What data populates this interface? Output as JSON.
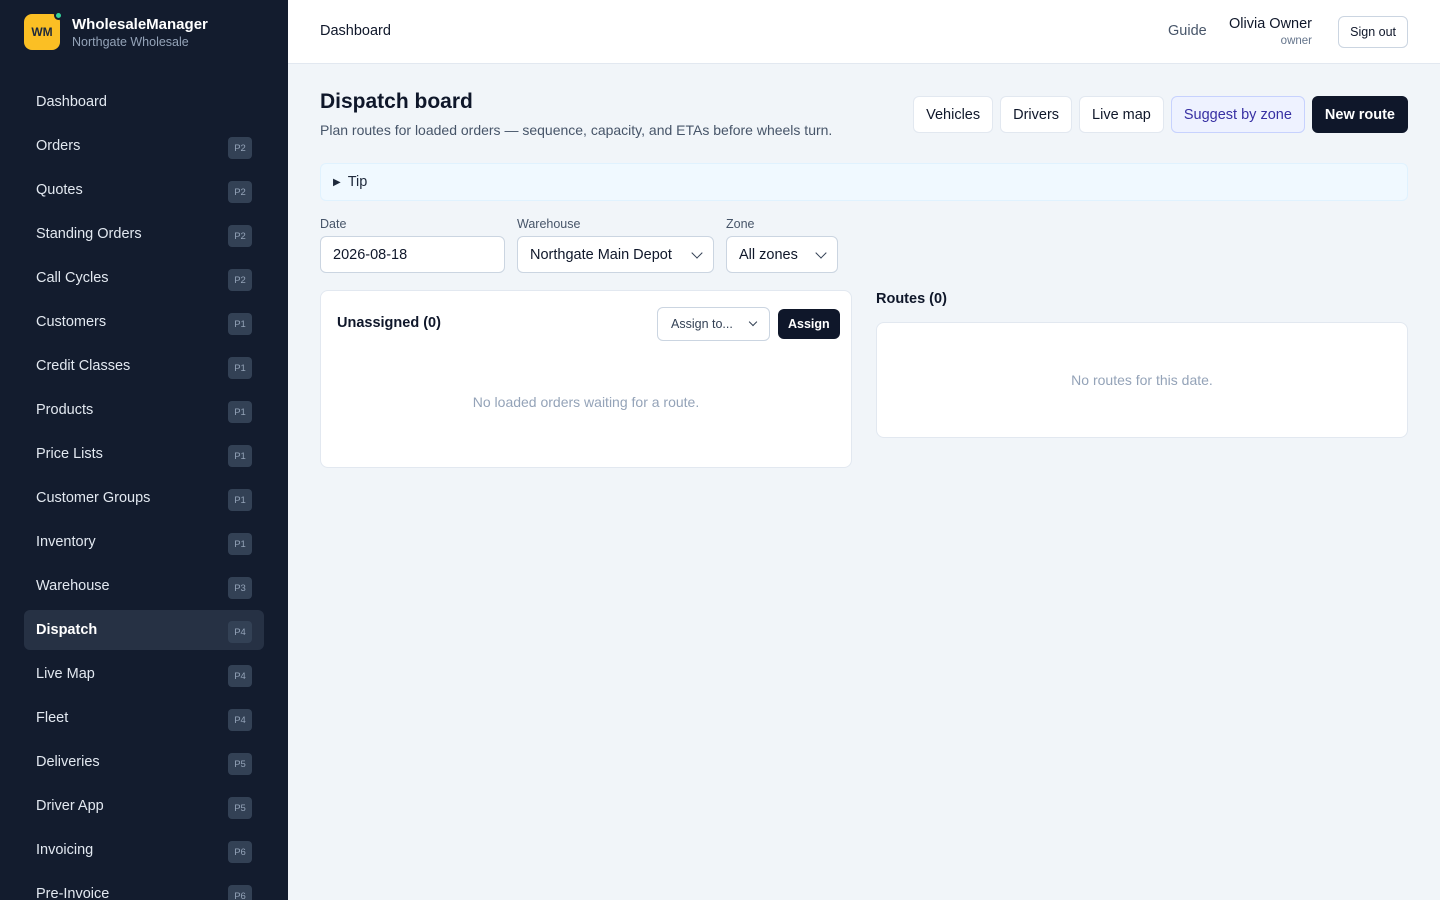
{
  "brand": {
    "logo": "WM",
    "name": "WholesaleManager",
    "company": "Northgate Wholesale"
  },
  "sidebar": {
    "items": [
      {
        "label": "Dashboard",
        "badge": ""
      },
      {
        "label": "Orders",
        "badge": "P2"
      },
      {
        "label": "Quotes",
        "badge": "P2"
      },
      {
        "label": "Standing Orders",
        "badge": "P2"
      },
      {
        "label": "Call Cycles",
        "badge": "P2"
      },
      {
        "label": "Customers",
        "badge": "P1"
      },
      {
        "label": "Credit Classes",
        "badge": "P1"
      },
      {
        "label": "Products",
        "badge": "P1"
      },
      {
        "label": "Price Lists",
        "badge": "P1"
      },
      {
        "label": "Customer Groups",
        "badge": "P1"
      },
      {
        "label": "Inventory",
        "badge": "P1"
      },
      {
        "label": "Warehouse",
        "badge": "P3"
      },
      {
        "label": "Dispatch",
        "badge": "P4",
        "active": true
      },
      {
        "label": "Live Map",
        "badge": "P4"
      },
      {
        "label": "Fleet",
        "badge": "P4"
      },
      {
        "label": "Deliveries",
        "badge": "P5"
      },
      {
        "label": "Driver App",
        "badge": "P5"
      },
      {
        "label": "Invoicing",
        "badge": "P6"
      },
      {
        "label": "Pre-Invoice",
        "badge": "P6"
      }
    ]
  },
  "header": {
    "breadcrumb": "Dashboard",
    "guide": "Guide",
    "user_name": "Olivia Owner",
    "user_role": "owner",
    "signout": "Sign out"
  },
  "page": {
    "title": "Dispatch board",
    "subtitle": "Plan routes for loaded orders — sequence, capacity, and ETAs before wheels turn.",
    "actions": {
      "vehicles": "Vehicles",
      "drivers": "Drivers",
      "live_map": "Live map",
      "suggest": "Suggest by zone",
      "new_route": "New route"
    },
    "tip": "Tip"
  },
  "filters": {
    "date_label": "Date",
    "date_value": "2026-08-18",
    "warehouse_label": "Warehouse",
    "warehouse_value": "Northgate Main Depot",
    "zone_label": "Zone",
    "zone_value": "All zones"
  },
  "unassigned": {
    "title": "Unassigned (0)",
    "assign_select": "Assign to...",
    "assign_button": "Assign",
    "empty": "No loaded orders waiting for a route."
  },
  "routes": {
    "title": "Routes (0)",
    "empty": "No routes for this date."
  },
  "colors": {
    "sidebar_bg": "#131c2e",
    "accent": "#fbbf24",
    "primary": "#0f172a",
    "suggest": "#3730a3"
  }
}
